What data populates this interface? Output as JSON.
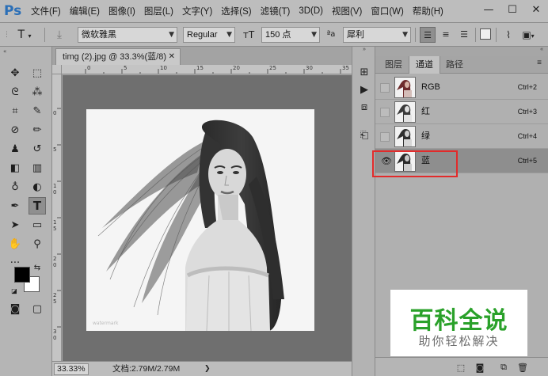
{
  "app": {
    "logo": "Ps"
  },
  "menu": [
    "文件(F)",
    "编辑(E)",
    "图像(I)",
    "图层(L)",
    "文字(Y)",
    "选择(S)",
    "滤镜(T)",
    "3D(D)",
    "视图(V)",
    "窗口(W)",
    "帮助(H)"
  ],
  "window_controls": [
    "minimize-icon",
    "maximize-icon",
    "close-icon"
  ],
  "options_bar": {
    "tool_icon": "type-tool-icon",
    "font_family": "微软雅黑",
    "font_style": "Regular",
    "font_size": "150 点",
    "aa_label": "ªa",
    "antialias": "犀利"
  },
  "document": {
    "tab_title": "timg (2).jpg @ 33.3%(蓝/8)",
    "ruler_h": [
      "0",
      "5",
      "10",
      "15",
      "20",
      "25",
      "30",
      "35"
    ],
    "ruler_v": [
      "0",
      "5",
      "1 0",
      "1 5",
      "2 0",
      "2 5",
      "3 0"
    ]
  },
  "status": {
    "zoom": "33.33%",
    "doc_info": "文档:2.79M/2.79M"
  },
  "panel": {
    "tabs": [
      "图层",
      "通道",
      "路径"
    ],
    "active_tab": 1,
    "channels": [
      {
        "name": "RGB",
        "shortcut": "Ctrl+2",
        "visible": false
      },
      {
        "name": "红",
        "shortcut": "Ctrl+3",
        "visible": false
      },
      {
        "name": "绿",
        "shortcut": "Ctrl+4",
        "visible": false
      },
      {
        "name": "蓝",
        "shortcut": "Ctrl+5",
        "visible": true
      }
    ],
    "selected_channel": 3
  },
  "watermark": {
    "title": "百科全说",
    "subtitle": "助你轻松解决"
  },
  "colors": {
    "highlight": "#e22b2b",
    "watermark_green": "#2aa12a",
    "ps_blue": "#2b6fb7"
  }
}
